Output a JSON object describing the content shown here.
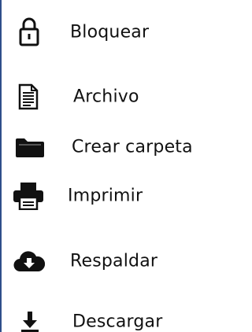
{
  "menu": {
    "items": [
      {
        "label": "Bloquear",
        "icon": "lock-icon"
      },
      {
        "label": "Archivo",
        "icon": "file-icon"
      },
      {
        "label": "Crear carpeta",
        "icon": "folder-icon"
      },
      {
        "label": "Imprimir",
        "icon": "printer-icon"
      },
      {
        "label": "Respaldar",
        "icon": "cloud-download-icon"
      },
      {
        "label": "Descargar",
        "icon": "download-icon"
      }
    ]
  },
  "colors": {
    "border": "#2f4f8a",
    "text": "#111111",
    "icon": "#111111",
    "background": "#ffffff"
  }
}
